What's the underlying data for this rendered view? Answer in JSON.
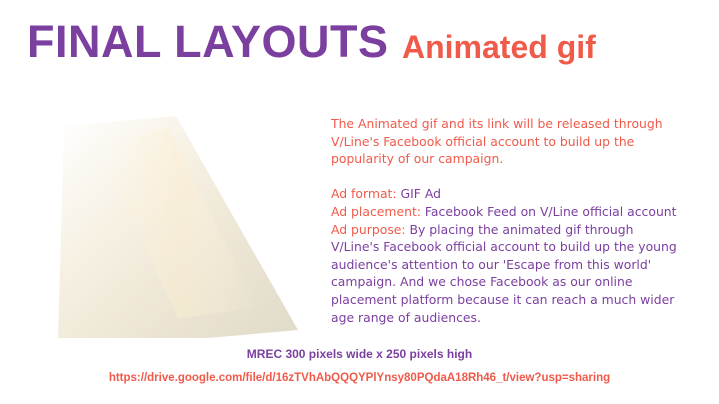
{
  "slide": {
    "title_main": "FINAL LAYOUTS",
    "title_sub": "Animated gif",
    "intro": "The Animated gif and its link will be released through V/Line's Facebook official account to build up the popularity of our campaign.",
    "format_label": "Ad format:",
    "format_value": " GIF Ad",
    "placement_label": "Ad placement:",
    "placement_value": " Facebook Feed on V/Line official account",
    "purpose_label": "Ad purpose:",
    "purpose_value": " By placing the animated gif through V/Line's Facebook official account to build up the young audience's attention to our 'Escape from this world' campaign. And we chose Facebook as our online placement platform because it can reach a much wider age range of audiences.",
    "spec": "MREC 300 pixels wide x 250 pixels high",
    "link": "https://drive.google.com/file/d/16zTVhAbQQQYPlYnsy80PQdaA18Rh46_t/view?usp=sharing"
  },
  "colors": {
    "purple": "#7b3fa0",
    "coral": "#f05a4a"
  }
}
